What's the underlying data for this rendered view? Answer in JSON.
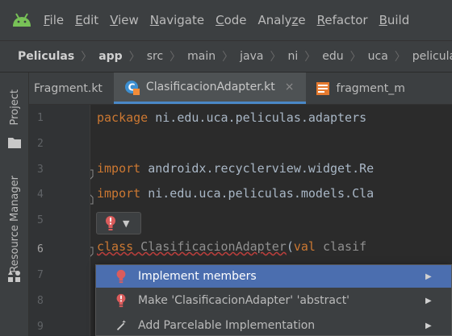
{
  "menubar": {
    "items": [
      {
        "mnemonic": "F",
        "rest": "ile"
      },
      {
        "mnemonic": "E",
        "rest": "dit"
      },
      {
        "mnemonic": "V",
        "rest": "iew"
      },
      {
        "mnemonic": "N",
        "rest": "avigate"
      },
      {
        "mnemonic": "C",
        "rest": "ode"
      },
      {
        "pre": "Analy",
        "mnemonic": "z",
        "rest": "e"
      },
      {
        "mnemonic": "R",
        "rest": "efactor"
      },
      {
        "mnemonic": "B",
        "rest": "uild"
      }
    ]
  },
  "breadcrumb": [
    "Peliculas",
    "app",
    "src",
    "main",
    "java",
    "ni",
    "edu",
    "uca",
    "peliculas"
  ],
  "toolstrip": {
    "project_label": "Project",
    "resource_manager_label": "Resource Manager"
  },
  "tabs": [
    {
      "label": "Fragment.kt"
    },
    {
      "label": "ClasificacionAdapter.kt",
      "close": "×"
    },
    {
      "label": "fragment_m"
    }
  ],
  "gutter": {
    "line_numbers": [
      "1",
      "2",
      "3",
      "4",
      "5",
      "6",
      "7",
      "8",
      "9"
    ]
  },
  "code": {
    "line1": {
      "kw": "package",
      "rest": " ni.edu.uca.peliculas.adapters"
    },
    "line3": {
      "kw": "import",
      "rest": " androidx.recyclerview.widget.Re"
    },
    "line4": {
      "kw": "import",
      "rest": " ni.edu.uca.peliculas.models.Cla"
    },
    "line6": {
      "kw": "class",
      "cls": " ClasificacionAdapter",
      "paren": "(",
      "kw2": "val",
      "rest": " clasif"
    }
  },
  "intention_popup": {
    "items": [
      {
        "label": "Implement members",
        "arrow": "▶"
      },
      {
        "label": "Make 'ClasificacionAdapter' 'abstract'",
        "arrow": "▶"
      },
      {
        "label": "Add Parcelable Implementation",
        "arrow": "▶"
      }
    ]
  },
  "colors": {
    "accent": "#4b6eaf",
    "error": "#db5c5c",
    "keyword": "#cc7832",
    "android_green": "#78c257"
  }
}
